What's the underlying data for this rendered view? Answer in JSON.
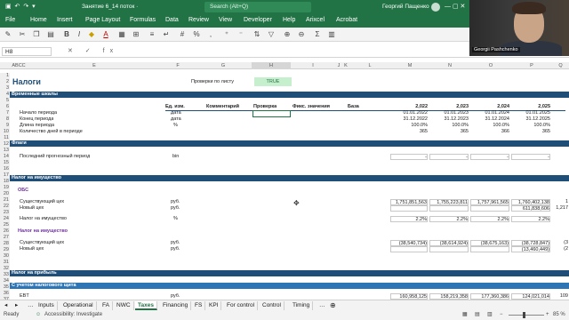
{
  "titlebar": {
    "quick_icons": "▣ ↶ ↷ ▾",
    "doc_title": "Занятие 6_14 поток ·",
    "search": "Search (Alt+Q)",
    "user": "Георгий Пащенко",
    "window_controls": "—  ▢  ✕"
  },
  "ribbon": {
    "tabs": [
      "File",
      "Home",
      "Insert",
      "Page Layout",
      "Formulas",
      "Data",
      "Review",
      "View",
      "Developer",
      "Help",
      "Arixcel",
      "Acrobat"
    ]
  },
  "formula_bar": {
    "name_box": "H8",
    "icons": "✕ ✓ fx"
  },
  "webcam": {
    "name": "Georgii Pashchenko"
  },
  "columns": {
    "c": "ABCC",
    "e": "E",
    "f": "F",
    "g": "G",
    "h": "H",
    "i": "I",
    "j": "J",
    "k": "K",
    "l": "L",
    "m": "M",
    "n": "N",
    "o": "O",
    "p": "P",
    "q": "Q"
  },
  "sheet": {
    "title": "Налоги",
    "check_label": "Проверки по листу",
    "check_value": "TRUE",
    "header_units": "Ед. изм.",
    "header_comment": "Комментарий",
    "header_check": "Проверка",
    "header_fixed": "Фикс. значения",
    "header_base": "База",
    "years": [
      "2,022",
      "2,023",
      "2,024",
      "2,025"
    ],
    "sections": {
      "timeline": "Временные шкалы",
      "flags": "Флаги",
      "property_tax": "Налог на имущество",
      "profit_tax": "Налог на прибыль",
      "profit_tax_sub": "С учетом налогового щита"
    },
    "rows": {
      "r8": {
        "label": "Начало периода",
        "unit": "дата",
        "values": [
          "01.01.2022",
          "01.01.2023",
          "01.01.2024",
          "01.01.2025"
        ]
      },
      "r9": {
        "label": "Конец периода",
        "unit": "дата",
        "values": [
          "31.12.2022",
          "31.12.2023",
          "31.12.2024",
          "31.12.2025"
        ]
      },
      "r10": {
        "label": "Длина периода",
        "unit": "%",
        "values": [
          "100.0%",
          "100.0%",
          "100.0%",
          "100.0%"
        ]
      },
      "r11": {
        "label": "Количество дней в периоде",
        "unit": "",
        "values": [
          "365",
          "365",
          "366",
          "365"
        ]
      },
      "r14": {
        "label": "Последний прогнозный период",
        "unit": "bin",
        "values": [
          "-",
          "-",
          "-",
          "-"
        ]
      },
      "r20": {
        "label": "ОБС"
      },
      "r22": {
        "label": "Существующий цех",
        "unit": "руб.",
        "values": [
          "1,751,851,563",
          "1,755,223,811",
          "1,757,961,565",
          "1,760,402,138"
        ],
        "extra": "1"
      },
      "r23": {
        "label": "Новый цех",
        "unit": "руб.",
        "values": [
          "",
          "",
          "",
          "611,838,606"
        ],
        "extra": "1,217"
      },
      "r25": {
        "label": "Налог на имущество",
        "unit": "%",
        "values": [
          "2.2%",
          "2.2%",
          "2.2%",
          "2.2%"
        ]
      },
      "r27": {
        "label": "Налог на имущество"
      },
      "r29": {
        "label": "Существующий цех",
        "unit": "руб.",
        "values": [
          "(38,540,734)",
          "(38,614,924)",
          "(38,675,163)",
          "(38,728,847)"
        ],
        "extra": "(3"
      },
      "r30": {
        "label": "Новый цех",
        "unit": "руб.",
        "values": [
          "",
          "",
          "",
          "(13,460,449)"
        ],
        "extra": "(2"
      },
      "r37": {
        "label": "EBT",
        "unit": "руб.",
        "values": [
          "160,958,125",
          "158,219,358",
          "177,360,386",
          "124,021,014"
        ],
        "extra": "109"
      }
    }
  },
  "sheet_tabs": [
    "Inputs",
    "Operational",
    "FA",
    "NWC",
    "Taxes",
    "Financing",
    "FS",
    "KPI",
    "For control",
    "Control",
    "Timing"
  ],
  "active_tab": "Taxes",
  "status": {
    "ready": "Ready",
    "accessibility": "Accessibility: Investigate",
    "zoom": "85 %"
  },
  "colors": {
    "excel_green": "#217346",
    "section_blue": "#1f4e79",
    "check_green": "#c6efce"
  }
}
